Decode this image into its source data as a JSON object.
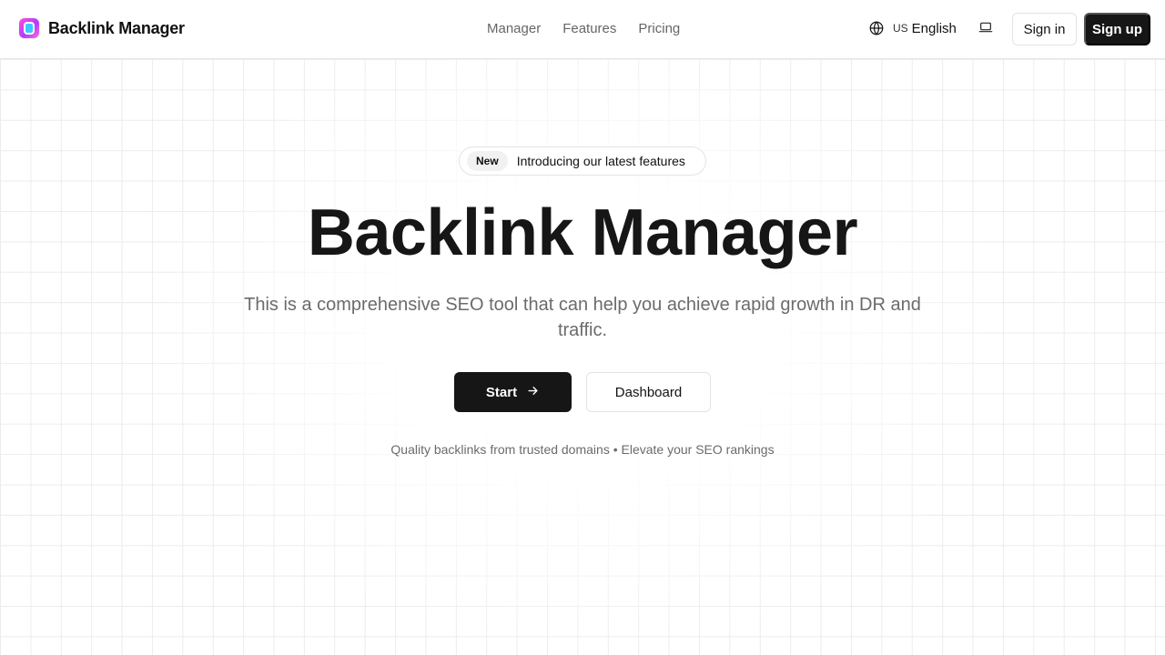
{
  "header": {
    "brand": "Backlink Manager",
    "nav": [
      "Manager",
      "Features",
      "Pricing"
    ],
    "language_code": "US",
    "language": "English",
    "sign_in": "Sign in",
    "sign_up": "Sign up"
  },
  "hero": {
    "badge": "New",
    "announcement": "Introducing our latest features",
    "title": "Backlink Manager",
    "subtitle": "This is a comprehensive SEO tool that can help you achieve rapid growth in DR and traffic.",
    "primary_button": "Start",
    "secondary_button": "Dashboard",
    "tagline": "Quality backlinks from trusted domains • Elevate your SEO rankings"
  },
  "icons": {
    "logo": "backlink-manager-logo-icon",
    "language": "globe-icon",
    "theme": "laptop-icon",
    "start_arrow": "arrow-right-icon"
  },
  "colors": {
    "primary": "#161616",
    "muted_text": "#6b6b6b",
    "border": "#e3e3e3",
    "grid": "#ececec"
  }
}
